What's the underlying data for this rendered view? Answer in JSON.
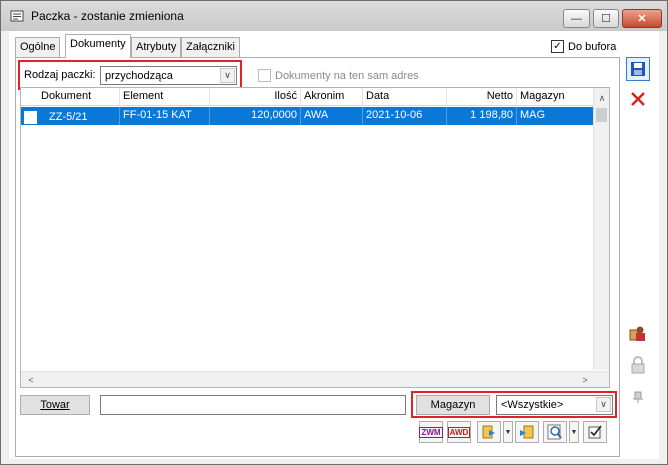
{
  "window": {
    "title": "Paczka - zostanie zmieniona",
    "minimize_glyph": "—",
    "maximize_glyph": "☐",
    "close_glyph": "✕"
  },
  "tabs": [
    {
      "label": "Ogólne",
      "active": false
    },
    {
      "label": "Dokumenty",
      "active": true
    },
    {
      "label": "Atrybuty",
      "active": false
    },
    {
      "label": "Załączniki",
      "active": false
    }
  ],
  "do_bufora": {
    "label": "Do bufora",
    "checked": true,
    "mark": "✓"
  },
  "filters": {
    "package_type_label": "Rodzaj paczki:",
    "package_type_value": "przychodząca",
    "same_address_label": "Dokumenty na ten sam adres",
    "same_address_checked": false
  },
  "grid": {
    "columns": [
      "Dokument",
      "Element",
      "Ilość",
      "Akronim",
      "Data",
      "Netto",
      "Magazyn"
    ],
    "rows": [
      {
        "checked": false,
        "dokument": "ZZ-5/21",
        "element": "FF-01-15 KAT",
        "ilosc": "120,0000",
        "akronim": "AWA",
        "data": "2021-10-06",
        "netto": "1 198,80",
        "magazyn": "MAG"
      }
    ],
    "scroll_up": "∧",
    "scroll_left": "<",
    "scroll_right": ">"
  },
  "bottom": {
    "towar_button": "Towar",
    "towar_value": "",
    "magazyn_button": "Magazyn",
    "magazyn_value": "<Wszystkie>"
  },
  "toolbar": {
    "zwm_label": "ZWM",
    "awd_label": "AWD"
  },
  "colors": {
    "selection": "#0a78d7",
    "highlight_frame": "#e0232b",
    "save_icon": "#2456b3",
    "delete_icon": "#d6261f"
  }
}
